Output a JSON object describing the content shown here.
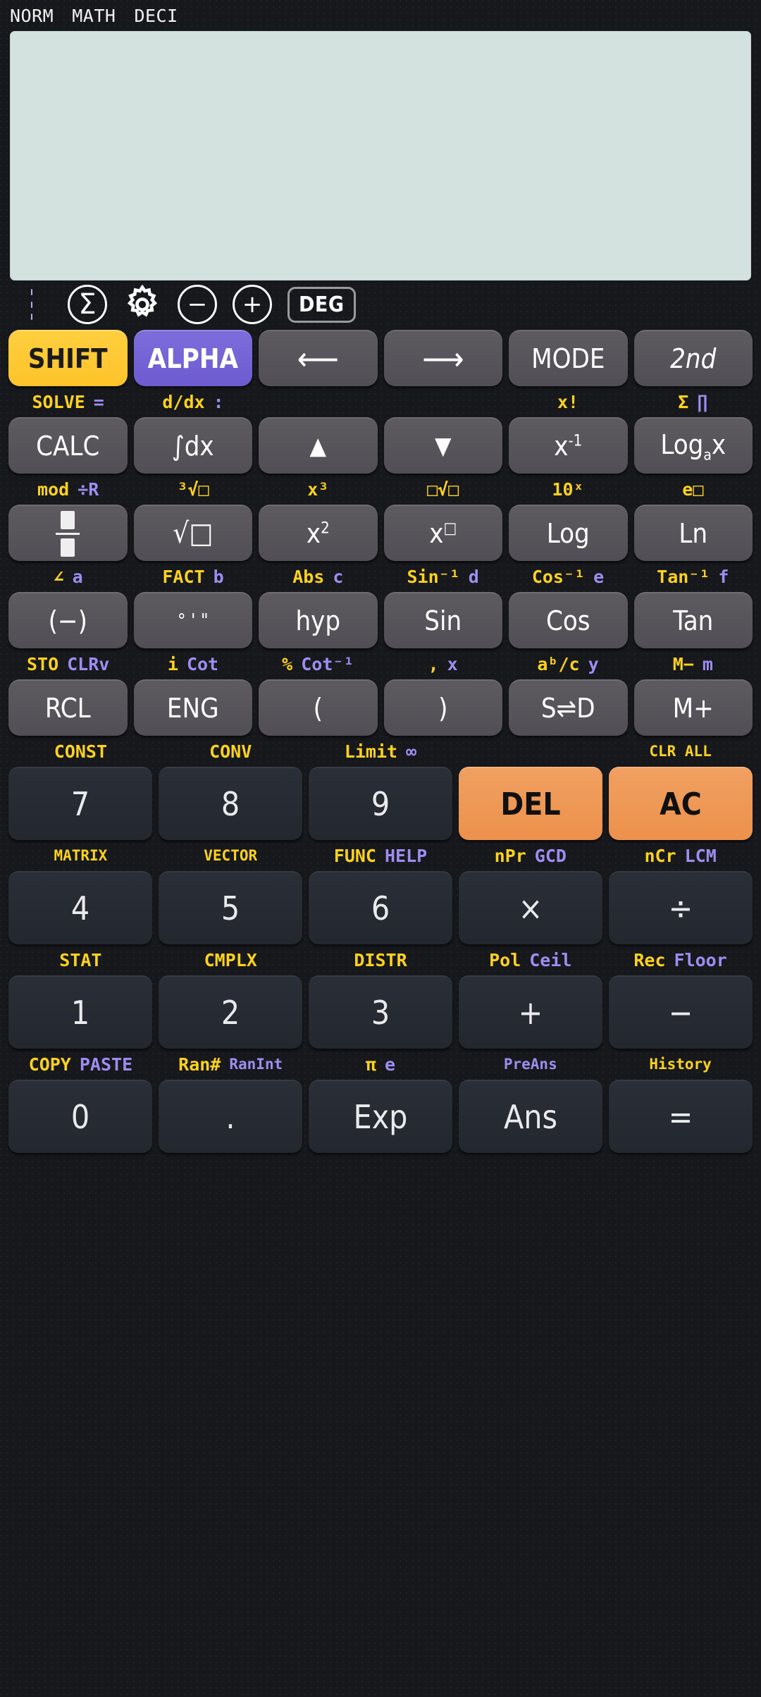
{
  "status_bar": {
    "mode1": "NORM",
    "mode2": "MATH",
    "mode3": "DECI"
  },
  "display": {
    "value": ""
  },
  "toolbar": {
    "menu": "menu-icon",
    "sigma": "Σ",
    "gear": "gear-icon",
    "minus": "−",
    "plus": "+",
    "angle_unit": "DEG"
  },
  "colors": {
    "shift": "#fdc32a",
    "alpha": "#6d5bd0",
    "orange": "#ec914c",
    "label_yellow": "#ffd21e",
    "label_purple": "#9f8cf0",
    "display_bg": "#d4e2df",
    "key_bg": "#514e55",
    "num_key_bg": "#23272e",
    "background": "#16181c"
  },
  "label_rows": [
    [
      {
        "y": "SOLVE",
        "p": "="
      },
      {
        "y": "d/dx",
        "p": ":"
      },
      {
        "y": "",
        "p": ""
      },
      {
        "y": "",
        "p": ""
      },
      {
        "y": "x!",
        "p": ""
      },
      {
        "y": "Σ",
        "p": "∏"
      }
    ],
    [
      {
        "y": "mod",
        "p": "÷R"
      },
      {
        "y": "³√□",
        "p": ""
      },
      {
        "y": "x³",
        "p": ""
      },
      {
        "y": "□√□",
        "p": ""
      },
      {
        "y": "10ˣ",
        "p": ""
      },
      {
        "y": "e□",
        "p": ""
      }
    ],
    [
      {
        "y": "∠",
        "p": "a"
      },
      {
        "y": "FACT",
        "p": "b"
      },
      {
        "y": "Abs",
        "p": "c"
      },
      {
        "y": "Sin⁻¹",
        "p": "d"
      },
      {
        "y": "Cos⁻¹",
        "p": "e"
      },
      {
        "y": "Tan⁻¹",
        "p": "f"
      }
    ],
    [
      {
        "y": "STO",
        "p": "CLRv"
      },
      {
        "y": "i",
        "p": "Cot"
      },
      {
        "y": "%",
        "p": "Cot⁻¹"
      },
      {
        "y": ",",
        "p": "x"
      },
      {
        "y": "aᵇ/c",
        "p": "y"
      },
      {
        "y": "M−",
        "p": "m"
      }
    ],
    [
      {
        "y": "CONST",
        "p": ""
      },
      {
        "y": "CONV",
        "p": ""
      },
      {
        "y": "Limit",
        "p": "∞"
      },
      {
        "y": "",
        "p": ""
      },
      {
        "y": "CLR ALL",
        "p": ""
      }
    ],
    [
      {
        "y": "MATRIX",
        "p": ""
      },
      {
        "y": "VECTOR",
        "p": ""
      },
      {
        "y": "FUNC",
        "p": "HELP"
      },
      {
        "y": "nPr",
        "p": "GCD"
      },
      {
        "y": "nCr",
        "p": "LCM"
      }
    ],
    [
      {
        "y": "STAT",
        "p": ""
      },
      {
        "y": "CMPLX",
        "p": ""
      },
      {
        "y": "DISTR",
        "p": ""
      },
      {
        "y": "Pol",
        "p": "Ceil"
      },
      {
        "y": "Rec",
        "p": "Floor"
      }
    ],
    [
      {
        "y": "COPY",
        "p": "PASTE"
      },
      {
        "y": "Ran#",
        "p": "RanInt"
      },
      {
        "y": "π",
        "p": "e"
      },
      {
        "y": "",
        "p": "PreAns"
      },
      {
        "y": "History",
        "p": ""
      }
    ]
  ],
  "key_rows": [
    [
      {
        "label": "SHIFT",
        "style": "shift"
      },
      {
        "label": "ALPHA",
        "style": "alpha"
      },
      {
        "label": "⟵",
        "style": "arrow"
      },
      {
        "label": "⟶",
        "style": "arrow"
      },
      {
        "label": "MODE",
        "style": ""
      },
      {
        "label": "2nd",
        "style": "italic"
      }
    ],
    [
      {
        "label": "CALC",
        "style": ""
      },
      {
        "label": "∫dx",
        "style": ""
      },
      {
        "label": "▲",
        "style": "tri"
      },
      {
        "label": "▼",
        "style": "tri"
      },
      {
        "label": "x⁻¹",
        "style": ""
      },
      {
        "label": "Logₐx",
        "style": ""
      }
    ],
    [
      {
        "label": "fraction-icon",
        "style": "frac"
      },
      {
        "label": "√□",
        "style": "sqrt"
      },
      {
        "label": "x²",
        "style": ""
      },
      {
        "label": "x□",
        "style": ""
      },
      {
        "label": "Log",
        "style": ""
      },
      {
        "label": "Ln",
        "style": ""
      }
    ],
    [
      {
        "label": "(−)",
        "style": ""
      },
      {
        "label": "° ' \"",
        "style": "small"
      },
      {
        "label": "hyp",
        "style": ""
      },
      {
        "label": "Sin",
        "style": ""
      },
      {
        "label": "Cos",
        "style": ""
      },
      {
        "label": "Tan",
        "style": ""
      }
    ],
    [
      {
        "label": "RCL",
        "style": ""
      },
      {
        "label": "ENG",
        "style": ""
      },
      {
        "label": "(",
        "style": ""
      },
      {
        "label": ")",
        "style": ""
      },
      {
        "label": "S⇌D",
        "style": ""
      },
      {
        "label": "M+",
        "style": ""
      }
    ],
    [
      {
        "label": "7",
        "style": "num"
      },
      {
        "label": "8",
        "style": "num"
      },
      {
        "label": "9",
        "style": "num"
      },
      {
        "label": "DEL",
        "style": "orange"
      },
      {
        "label": "AC",
        "style": "orange"
      }
    ],
    [
      {
        "label": "4",
        "style": "num"
      },
      {
        "label": "5",
        "style": "num"
      },
      {
        "label": "6",
        "style": "num"
      },
      {
        "label": "×",
        "style": "num"
      },
      {
        "label": "÷",
        "style": "num"
      }
    ],
    [
      {
        "label": "1",
        "style": "num"
      },
      {
        "label": "2",
        "style": "num"
      },
      {
        "label": "3",
        "style": "num"
      },
      {
        "label": "+",
        "style": "num"
      },
      {
        "label": "−",
        "style": "num"
      }
    ],
    [
      {
        "label": "0",
        "style": "num"
      },
      {
        "label": ".",
        "style": "num"
      },
      {
        "label": "Exp",
        "style": "num"
      },
      {
        "label": "Ans",
        "style": "num"
      },
      {
        "label": "=",
        "style": "num"
      }
    ]
  ]
}
